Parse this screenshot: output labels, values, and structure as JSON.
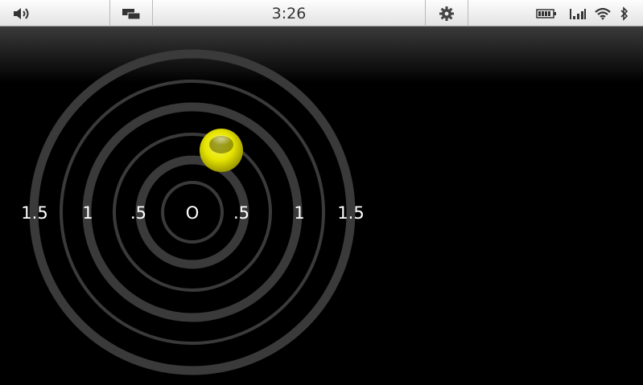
{
  "status_bar": {
    "time": "3:26",
    "left_icons": [
      "volume-icon",
      "windows-icon"
    ],
    "right_icons": [
      "settings-icon",
      "battery-icon",
      "signal-icon",
      "wifi-icon",
      "bluetooth-icon"
    ]
  },
  "bubble_level": {
    "scale_labels": [
      ".5",
      "1",
      "1.5"
    ],
    "center_label": "O",
    "bubble_color": "#e8e600",
    "ring_color": "#3a3a3a",
    "tick_labels": [
      {
        "name": "label-left-1-5",
        "text": "1.5",
        "value": -1.5
      },
      {
        "name": "label-left-1",
        "text": "1",
        "value": -1
      },
      {
        "name": "label-left-0-5",
        "text": ".5",
        "value": -0.5
      },
      {
        "name": "label-center",
        "text": "O",
        "value": 0
      },
      {
        "name": "label-right-0-5",
        "text": ".5",
        "value": 0.5
      },
      {
        "name": "label-right-1",
        "text": "1",
        "value": 1
      },
      {
        "name": "label-right-1-5",
        "text": "1.5",
        "value": 1.5
      }
    ]
  }
}
